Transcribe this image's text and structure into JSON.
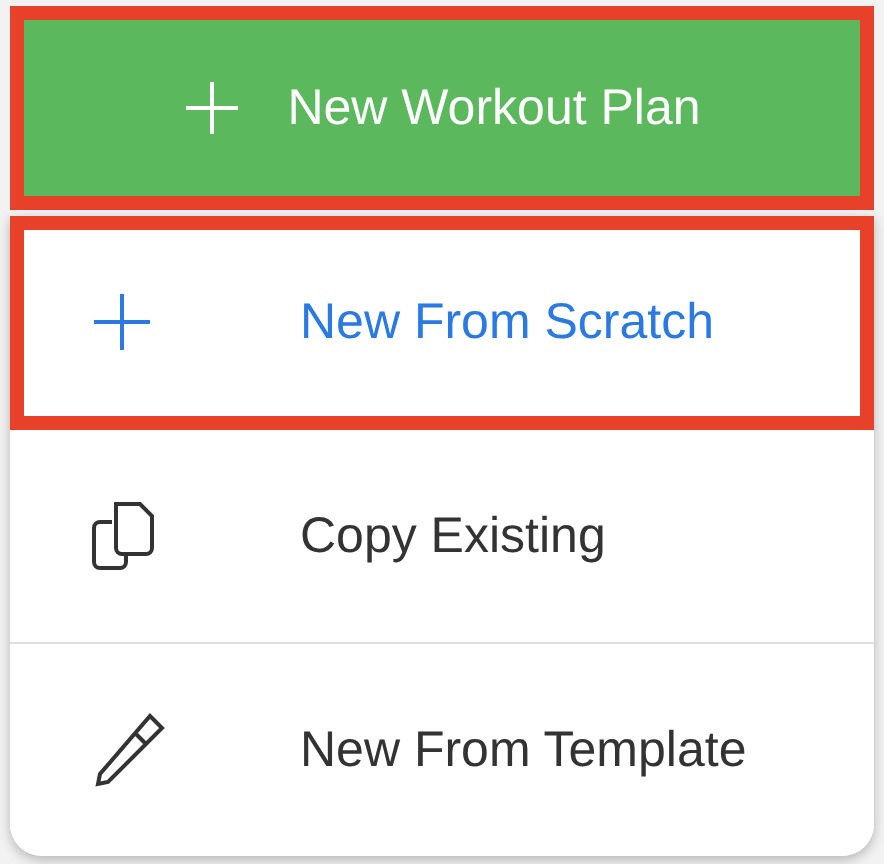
{
  "button": {
    "label": "New Workout Plan",
    "highlighted": true
  },
  "menu": [
    {
      "kind": "plus",
      "label": "New From Scratch",
      "selected": true,
      "highlighted": true
    },
    {
      "kind": "copy",
      "label": "Copy Existing",
      "selected": false,
      "highlighted": false
    },
    {
      "kind": "pencil",
      "label": "New From Template",
      "selected": false,
      "highlighted": false
    }
  ]
}
